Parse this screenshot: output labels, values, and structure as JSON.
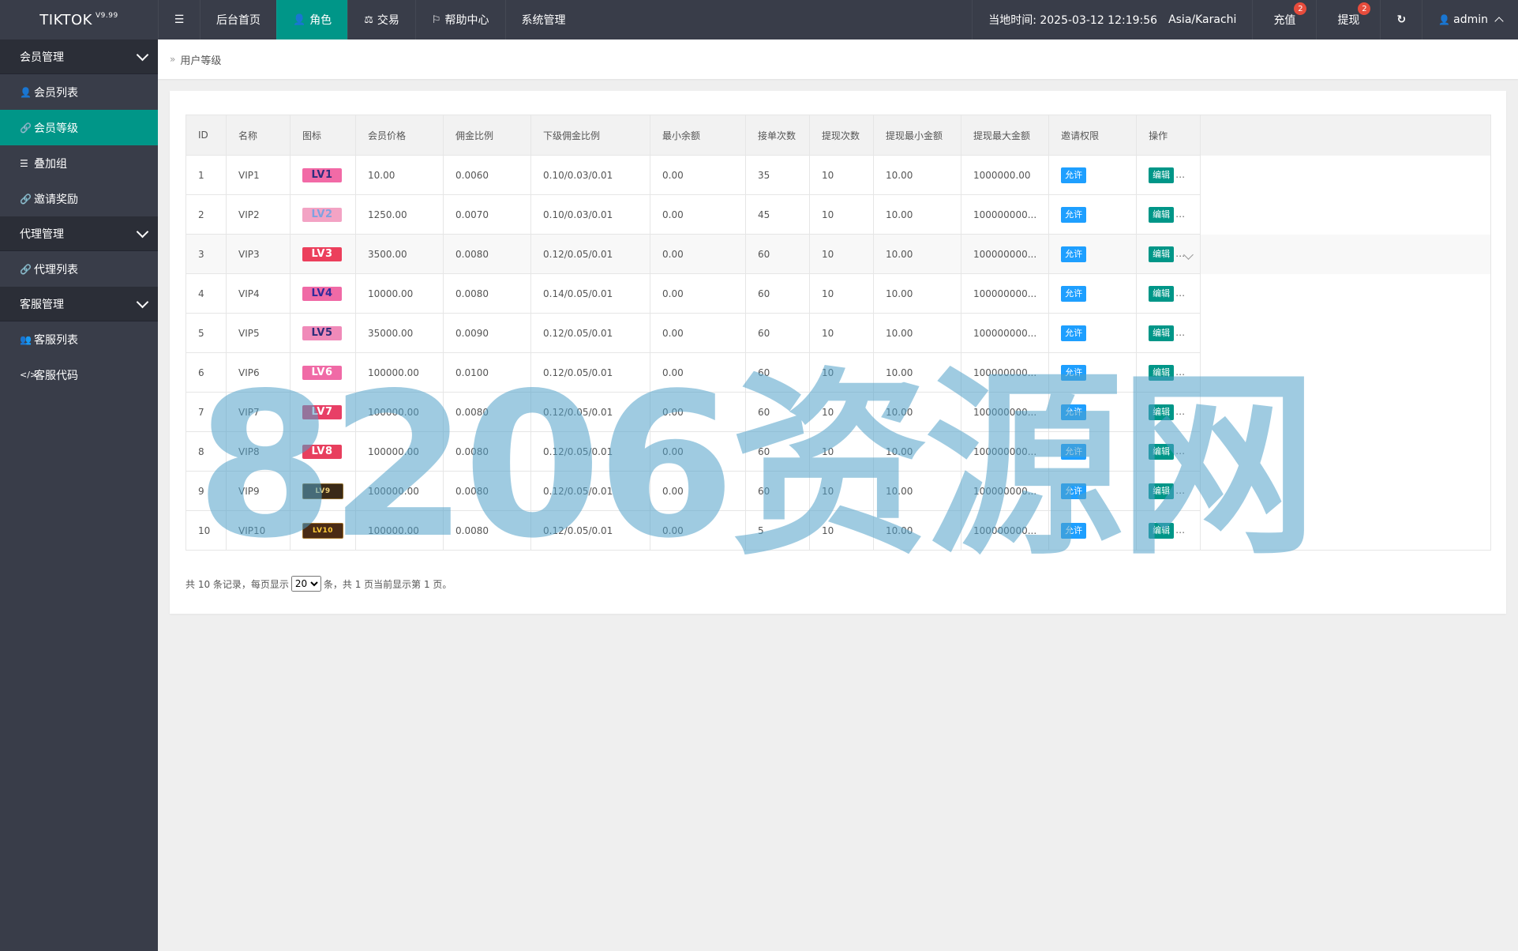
{
  "app": {
    "logo": "TIKTOK",
    "version": "V9.99"
  },
  "nav": {
    "toggle_icon": "menu-icon",
    "items": [
      {
        "label": "后台首页",
        "icon": ""
      },
      {
        "label": "角色",
        "icon": "user-icon"
      },
      {
        "label": "交易",
        "icon": "scale-icon"
      },
      {
        "label": "帮助中心",
        "icon": "flag-icon"
      },
      {
        "label": "系统管理",
        "icon": ""
      }
    ],
    "active": "角色"
  },
  "header_right": {
    "time_text": "当地时间: 2025-03-12 12:19:56",
    "timezone": "Asia/Karachi",
    "recharge_label": "充值",
    "recharge_badge": "2",
    "withdraw_label": "提现",
    "withdraw_badge": "2",
    "refresh_icon": "refresh-icon",
    "user_label": "admin"
  },
  "sidebar": {
    "groups": [
      {
        "label": "会员管理",
        "items": [
          {
            "label": "会员列表",
            "icon": "user-icon"
          },
          {
            "label": "会员等级",
            "icon": "link-icon",
            "active": true
          },
          {
            "label": "叠加组",
            "icon": "list-icon"
          },
          {
            "label": "邀请奖励",
            "icon": "link-icon"
          }
        ]
      },
      {
        "label": "代理管理",
        "items": [
          {
            "label": "代理列表",
            "icon": "link-icon"
          }
        ]
      },
      {
        "label": "客服管理",
        "items": [
          {
            "label": "客服列表",
            "icon": "users-icon"
          },
          {
            "label": "客服代码",
            "icon": "code-icon"
          }
        ]
      }
    ]
  },
  "breadcrumb": {
    "current": "用户等级"
  },
  "table": {
    "headers": [
      "ID",
      "名称",
      "图标",
      "会员价格",
      "佣金比例",
      "下级佣金比例",
      "最小余额",
      "接单次数",
      "提现次数",
      "提现最小金额",
      "提现最大金额",
      "邀请权限",
      "操作"
    ],
    "rows": [
      {
        "id": "1",
        "name": "VIP1",
        "icon": "LV1",
        "price": "10.00",
        "rate": "0.0060",
        "sub_rate": "0.10/0.03/0.01",
        "min_balance": "0.00",
        "orders": "35",
        "withdraw_times": "10",
        "withdraw_min": "10.00",
        "withdraw_max": "1000000.00",
        "invite": "允许",
        "action": "编辑"
      },
      {
        "id": "2",
        "name": "VIP2",
        "icon": "LV2",
        "price": "1250.00",
        "rate": "0.0070",
        "sub_rate": "0.10/0.03/0.01",
        "min_balance": "0.00",
        "orders": "45",
        "withdraw_times": "10",
        "withdraw_min": "10.00",
        "withdraw_max": "100000000...",
        "invite": "允许",
        "action": "编辑"
      },
      {
        "id": "3",
        "name": "VIP3",
        "icon": "LV3",
        "price": "3500.00",
        "rate": "0.0080",
        "sub_rate": "0.12/0.05/0.01",
        "min_balance": "0.00",
        "orders": "60",
        "withdraw_times": "10",
        "withdraw_min": "10.00",
        "withdraw_max": "100000000...",
        "invite": "允许",
        "action": "编辑"
      },
      {
        "id": "4",
        "name": "VIP4",
        "icon": "LV4",
        "price": "10000.00",
        "rate": "0.0080",
        "sub_rate": "0.14/0.05/0.01",
        "min_balance": "0.00",
        "orders": "60",
        "withdraw_times": "10",
        "withdraw_min": "10.00",
        "withdraw_max": "100000000...",
        "invite": "允许",
        "action": "编辑"
      },
      {
        "id": "5",
        "name": "VIP5",
        "icon": "LV5",
        "price": "35000.00",
        "rate": "0.0090",
        "sub_rate": "0.12/0.05/0.01",
        "min_balance": "0.00",
        "orders": "60",
        "withdraw_times": "10",
        "withdraw_min": "10.00",
        "withdraw_max": "100000000...",
        "invite": "允许",
        "action": "编辑"
      },
      {
        "id": "6",
        "name": "VIP6",
        "icon": "LV6",
        "price": "100000.00",
        "rate": "0.0100",
        "sub_rate": "0.12/0.05/0.01",
        "min_balance": "0.00",
        "orders": "60",
        "withdraw_times": "10",
        "withdraw_min": "10.00",
        "withdraw_max": "100000000...",
        "invite": "允许",
        "action": "编辑"
      },
      {
        "id": "7",
        "name": "VIP7",
        "icon": "LV7",
        "price": "100000.00",
        "rate": "0.0080",
        "sub_rate": "0.12/0.05/0.01",
        "min_balance": "0.00",
        "orders": "60",
        "withdraw_times": "10",
        "withdraw_min": "10.00",
        "withdraw_max": "100000000...",
        "invite": "允许",
        "action": "编辑"
      },
      {
        "id": "8",
        "name": "VIP8",
        "icon": "LV8",
        "price": "100000.00",
        "rate": "0.0080",
        "sub_rate": "0.12/0.05/0.01",
        "min_balance": "0.00",
        "orders": "60",
        "withdraw_times": "10",
        "withdraw_min": "10.00",
        "withdraw_max": "100000000...",
        "invite": "允许",
        "action": "编辑"
      },
      {
        "id": "9",
        "name": "VIP9",
        "icon": "LV9",
        "price": "100000.00",
        "rate": "0.0080",
        "sub_rate": "0.12/0.05/0.01",
        "min_balance": "0.00",
        "orders": "60",
        "withdraw_times": "10",
        "withdraw_min": "10.00",
        "withdraw_max": "100000000...",
        "invite": "允许",
        "action": "编辑"
      },
      {
        "id": "10",
        "name": "VIP10",
        "icon": "LV10",
        "price": "100000.00",
        "rate": "0.0080",
        "sub_rate": "0.12/0.05/0.01",
        "min_balance": "0.00",
        "orders": "5",
        "withdraw_times": "10",
        "withdraw_min": "10.00",
        "withdraw_max": "100000000...",
        "invite": "允许",
        "action": "编辑"
      }
    ]
  },
  "pager": {
    "before": "共 10 条记录，每页显示",
    "page_size": "20",
    "after": "条，共 1 页当前显示第 1 页。"
  },
  "watermark": "8206资源网"
}
